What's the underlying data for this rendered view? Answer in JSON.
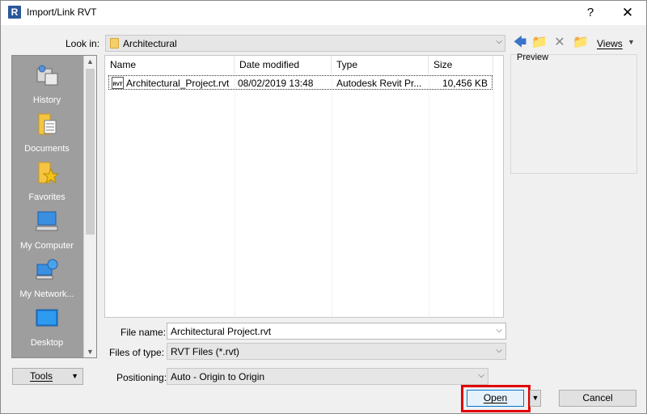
{
  "window": {
    "title": "Import/Link RVT",
    "app_icon_letter": "R",
    "help_glyph": "?",
    "close_glyph": "✕"
  },
  "look_in": {
    "label": "Look in:",
    "value": "Architectural"
  },
  "toolbar": {
    "icons": [
      "back-arrow-icon",
      "up-folder-icon",
      "delete-icon",
      "new-folder-icon"
    ],
    "views_label": "Views"
  },
  "places": [
    {
      "label": "History",
      "icon": "history-icon"
    },
    {
      "label": "Documents",
      "icon": "documents-icon"
    },
    {
      "label": "Favorites",
      "icon": "favorites-icon"
    },
    {
      "label": "My Computer",
      "icon": "my-computer-icon"
    },
    {
      "label": "My Network...",
      "icon": "my-network-icon"
    },
    {
      "label": "Desktop",
      "icon": "desktop-icon"
    }
  ],
  "file_list": {
    "columns": [
      "Name",
      "Date modified",
      "Type",
      "Size"
    ],
    "rows": [
      {
        "name": "Architectural_Project.rvt",
        "date": "08/02/2019 13:48",
        "type": "Autodesk Revit Pr...",
        "size": "10,456 KB",
        "icon_text": "RVT"
      }
    ]
  },
  "preview": {
    "label": "Preview"
  },
  "fields": {
    "file_name_label": "File name:",
    "file_name_value": "Architectural Project.rvt",
    "file_type_label": "Files of type:",
    "file_type_value": "RVT Files  (*.rvt)",
    "positioning_label": "Positioning:",
    "positioning_value": "Auto - Origin to Origin"
  },
  "buttons": {
    "tools": "Tools",
    "open": "Open",
    "cancel": "Cancel"
  },
  "colors": {
    "places_bg": "#9e9e9e",
    "highlight": "#e00000",
    "accent": "#0078d7"
  }
}
